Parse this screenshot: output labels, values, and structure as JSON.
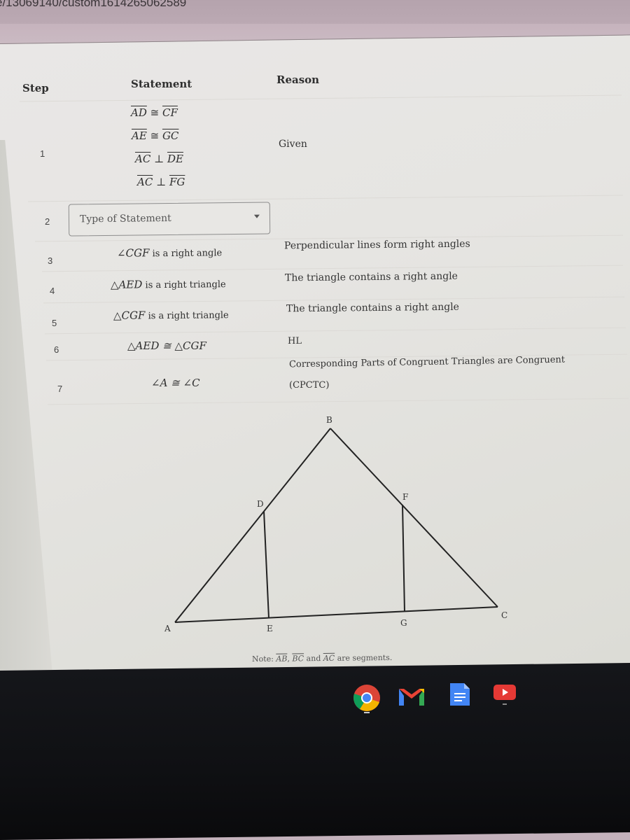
{
  "browser": {
    "url_fragment": "e/13069140/custom1614265062589"
  },
  "table": {
    "headers": {
      "step": "Step",
      "statement": "Statement",
      "reason": "Reason"
    },
    "rows": [
      {
        "step": "1",
        "statements": [
          {
            "left": "AD",
            "op": "≅",
            "right": "CF"
          },
          {
            "left": "AE",
            "op": "≅",
            "right": "GC"
          },
          {
            "left": "AC",
            "op": "⊥",
            "right": "DE"
          },
          {
            "left": "AC",
            "op": "⊥",
            "right": "FG"
          }
        ],
        "reason": "Given"
      },
      {
        "step": "2",
        "dropdown_placeholder": "Type of Statement",
        "reason": ""
      },
      {
        "step": "3",
        "statement_math": "∠CGF",
        "statement_text": " is a right angle",
        "reason": "Perpendicular lines form right angles"
      },
      {
        "step": "4",
        "statement_math": "△AED",
        "statement_text": " is a right triangle",
        "reason": "The triangle contains a right angle"
      },
      {
        "step": "5",
        "statement_math": "△CGF",
        "statement_text": " is a right triangle",
        "reason": "The triangle contains a right angle"
      },
      {
        "step": "6",
        "statement_math": "△AED ≅ △CGF",
        "statement_text": "",
        "reason": "HL"
      },
      {
        "step": "7",
        "statement_math": "∠A ≅ ∠C",
        "statement_text": "",
        "reason_line1": "Corresponding Parts of Congruent Triangles are Congruent",
        "reason_line2": "(CPCTC)"
      }
    ]
  },
  "figure": {
    "points": {
      "A": "A",
      "B": "B",
      "C": "C",
      "D": "D",
      "E": "E",
      "F": "F",
      "G": "G"
    },
    "note_prefix": "Note: ",
    "note_seg1": "AB",
    "note_sep": ", ",
    "note_seg2": "BC",
    "note_and": " and ",
    "note_seg3": "AC",
    "note_suffix": " are segments."
  },
  "dock": {
    "apps": [
      {
        "name": "Chrome",
        "icon": "chrome-icon",
        "active": true
      },
      {
        "name": "Gmail",
        "icon": "gmail-icon",
        "active": false
      },
      {
        "name": "Docs",
        "icon": "docs-icon",
        "active": false
      },
      {
        "name": "YouTube",
        "icon": "youtube-icon",
        "active": true
      }
    ]
  }
}
